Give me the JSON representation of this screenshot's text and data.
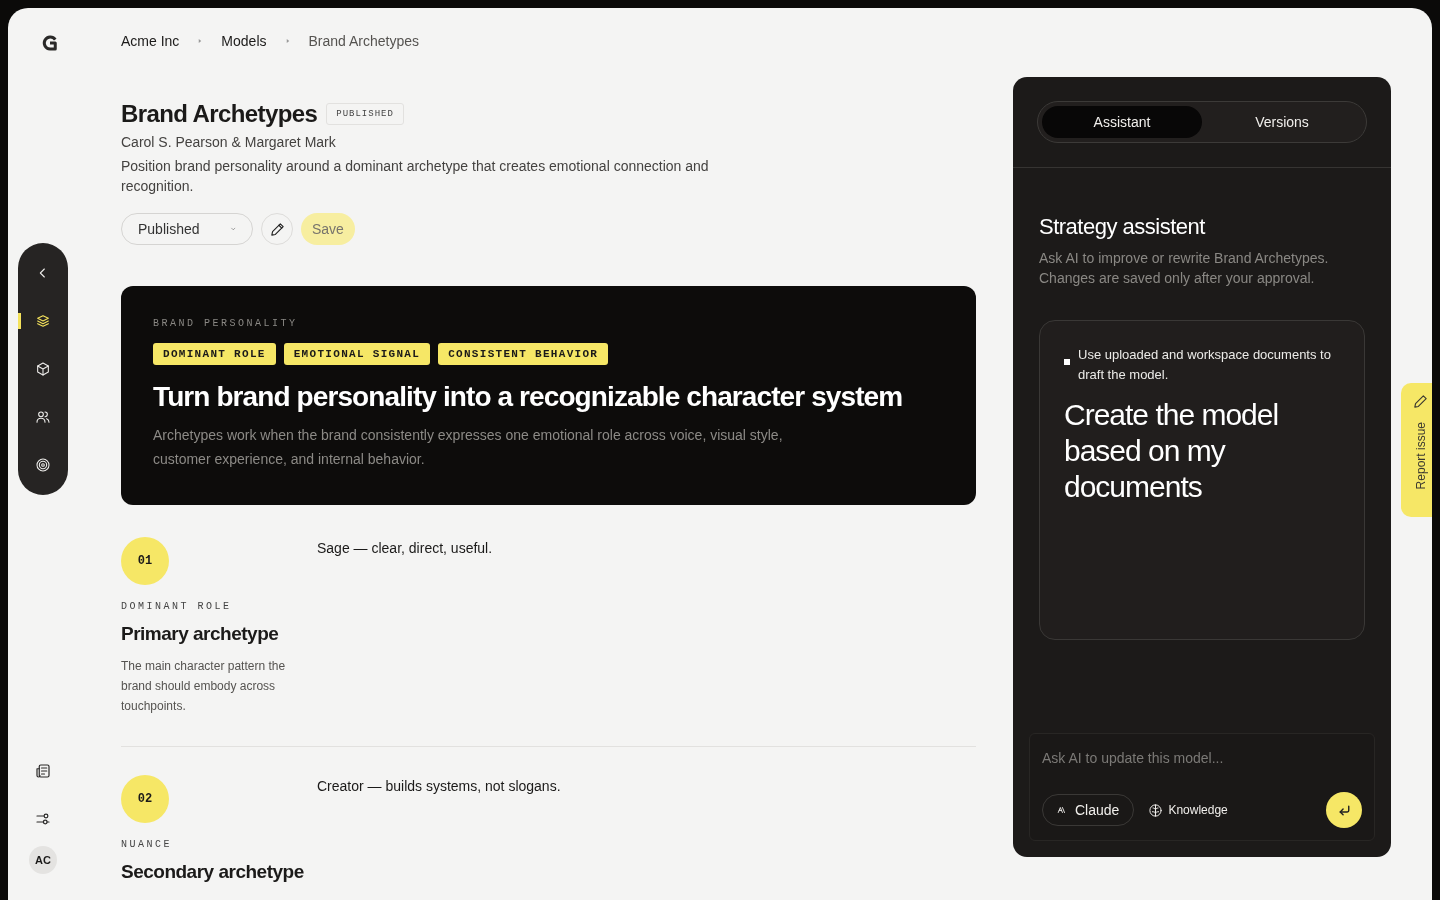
{
  "breadcrumb": [
    {
      "label": "Acme Inc",
      "current": false
    },
    {
      "label": "Models",
      "current": false
    },
    {
      "label": "Brand Archetypes",
      "current": true
    }
  ],
  "rail": {
    "items": [
      {
        "kind": "back",
        "selected": false
      },
      {
        "kind": "layers",
        "selected": true
      },
      {
        "kind": "cube",
        "selected": false
      },
      {
        "kind": "people",
        "selected": false
      },
      {
        "kind": "target",
        "selected": false
      }
    ],
    "bottom": [
      {
        "kind": "news"
      },
      {
        "kind": "sliders"
      }
    ],
    "avatar": "AC"
  },
  "model": {
    "title": "Brand Archetypes",
    "badge": "PUBLISHED",
    "authors": "Carol S. Pearson & Margaret Mark",
    "description": "Position brand personality around a dominant archetype that creates emotional connection and recognition."
  },
  "actions": {
    "status": "Published",
    "save": "Save"
  },
  "hero": {
    "eyebrow": "BRAND PERSONALITY",
    "tags": [
      "DOMINANT ROLE",
      "EMOTIONAL SIGNAL",
      "CONSISTENT BEHAVIOR"
    ],
    "headline": "Turn brand personality into a recognizable character system",
    "body": "Archetypes work when the brand consistently expresses one emotional role across voice, visual style, customer experience, and internal behavior."
  },
  "sections": [
    {
      "number": "01",
      "label": "DOMINANT ROLE",
      "title": "Primary archetype",
      "description": "The main character pattern the brand should embody across touchpoints.",
      "content": "Sage — clear, direct, useful."
    },
    {
      "number": "02",
      "label": "NUANCE",
      "title": "Secondary archetype",
      "content": "Creator — builds systems, not slogans."
    }
  ],
  "panel": {
    "tabs": [
      {
        "label": "Assistant",
        "selected": true
      },
      {
        "label": "Versions",
        "selected": false
      }
    ],
    "title": "Strategy assistent",
    "subtitle": "Ask AI to improve or rewrite Brand Archetypes. Changes are saved only after your approval.",
    "suggestion": {
      "hint": "Use uploaded and workspace documents to draft the model.",
      "prompt": "Create the model based on my documents"
    },
    "input": {
      "placeholder": "Ask AI to update this model..."
    },
    "model_button": "Claude",
    "knowledge_button": "Knowledge"
  },
  "report": "Report issue"
}
